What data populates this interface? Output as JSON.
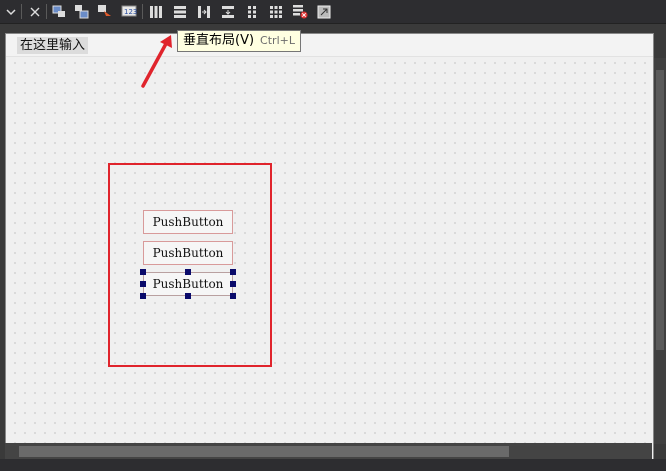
{
  "toolbar": {
    "icons": [
      "dropdown-icon",
      "close-icon",
      "edit-widgets-icon",
      "edit-signals-icon",
      "edit-buddies-icon",
      "edit-tab-order-icon",
      "horizontal-layout-icon",
      "vertical-layout-icon",
      "horizontal-splitter-icon",
      "vertical-splitter-icon",
      "form-layout-icon",
      "grid-layout-icon",
      "break-layout-icon",
      "adjust-size-icon"
    ]
  },
  "tooltip": {
    "label": "垂直布局(V)",
    "shortcut": "Ctrl+L"
  },
  "form": {
    "menu_placeholder": "在这里输入",
    "buttons": [
      {
        "label": "PushButton"
      },
      {
        "label": "PushButton"
      },
      {
        "label": "PushButton",
        "selected": true
      }
    ]
  },
  "colors": {
    "annotation_red": "#e0242c",
    "selection_handle": "#0a0a6a",
    "tooltip_bg": "#ffffe1"
  }
}
